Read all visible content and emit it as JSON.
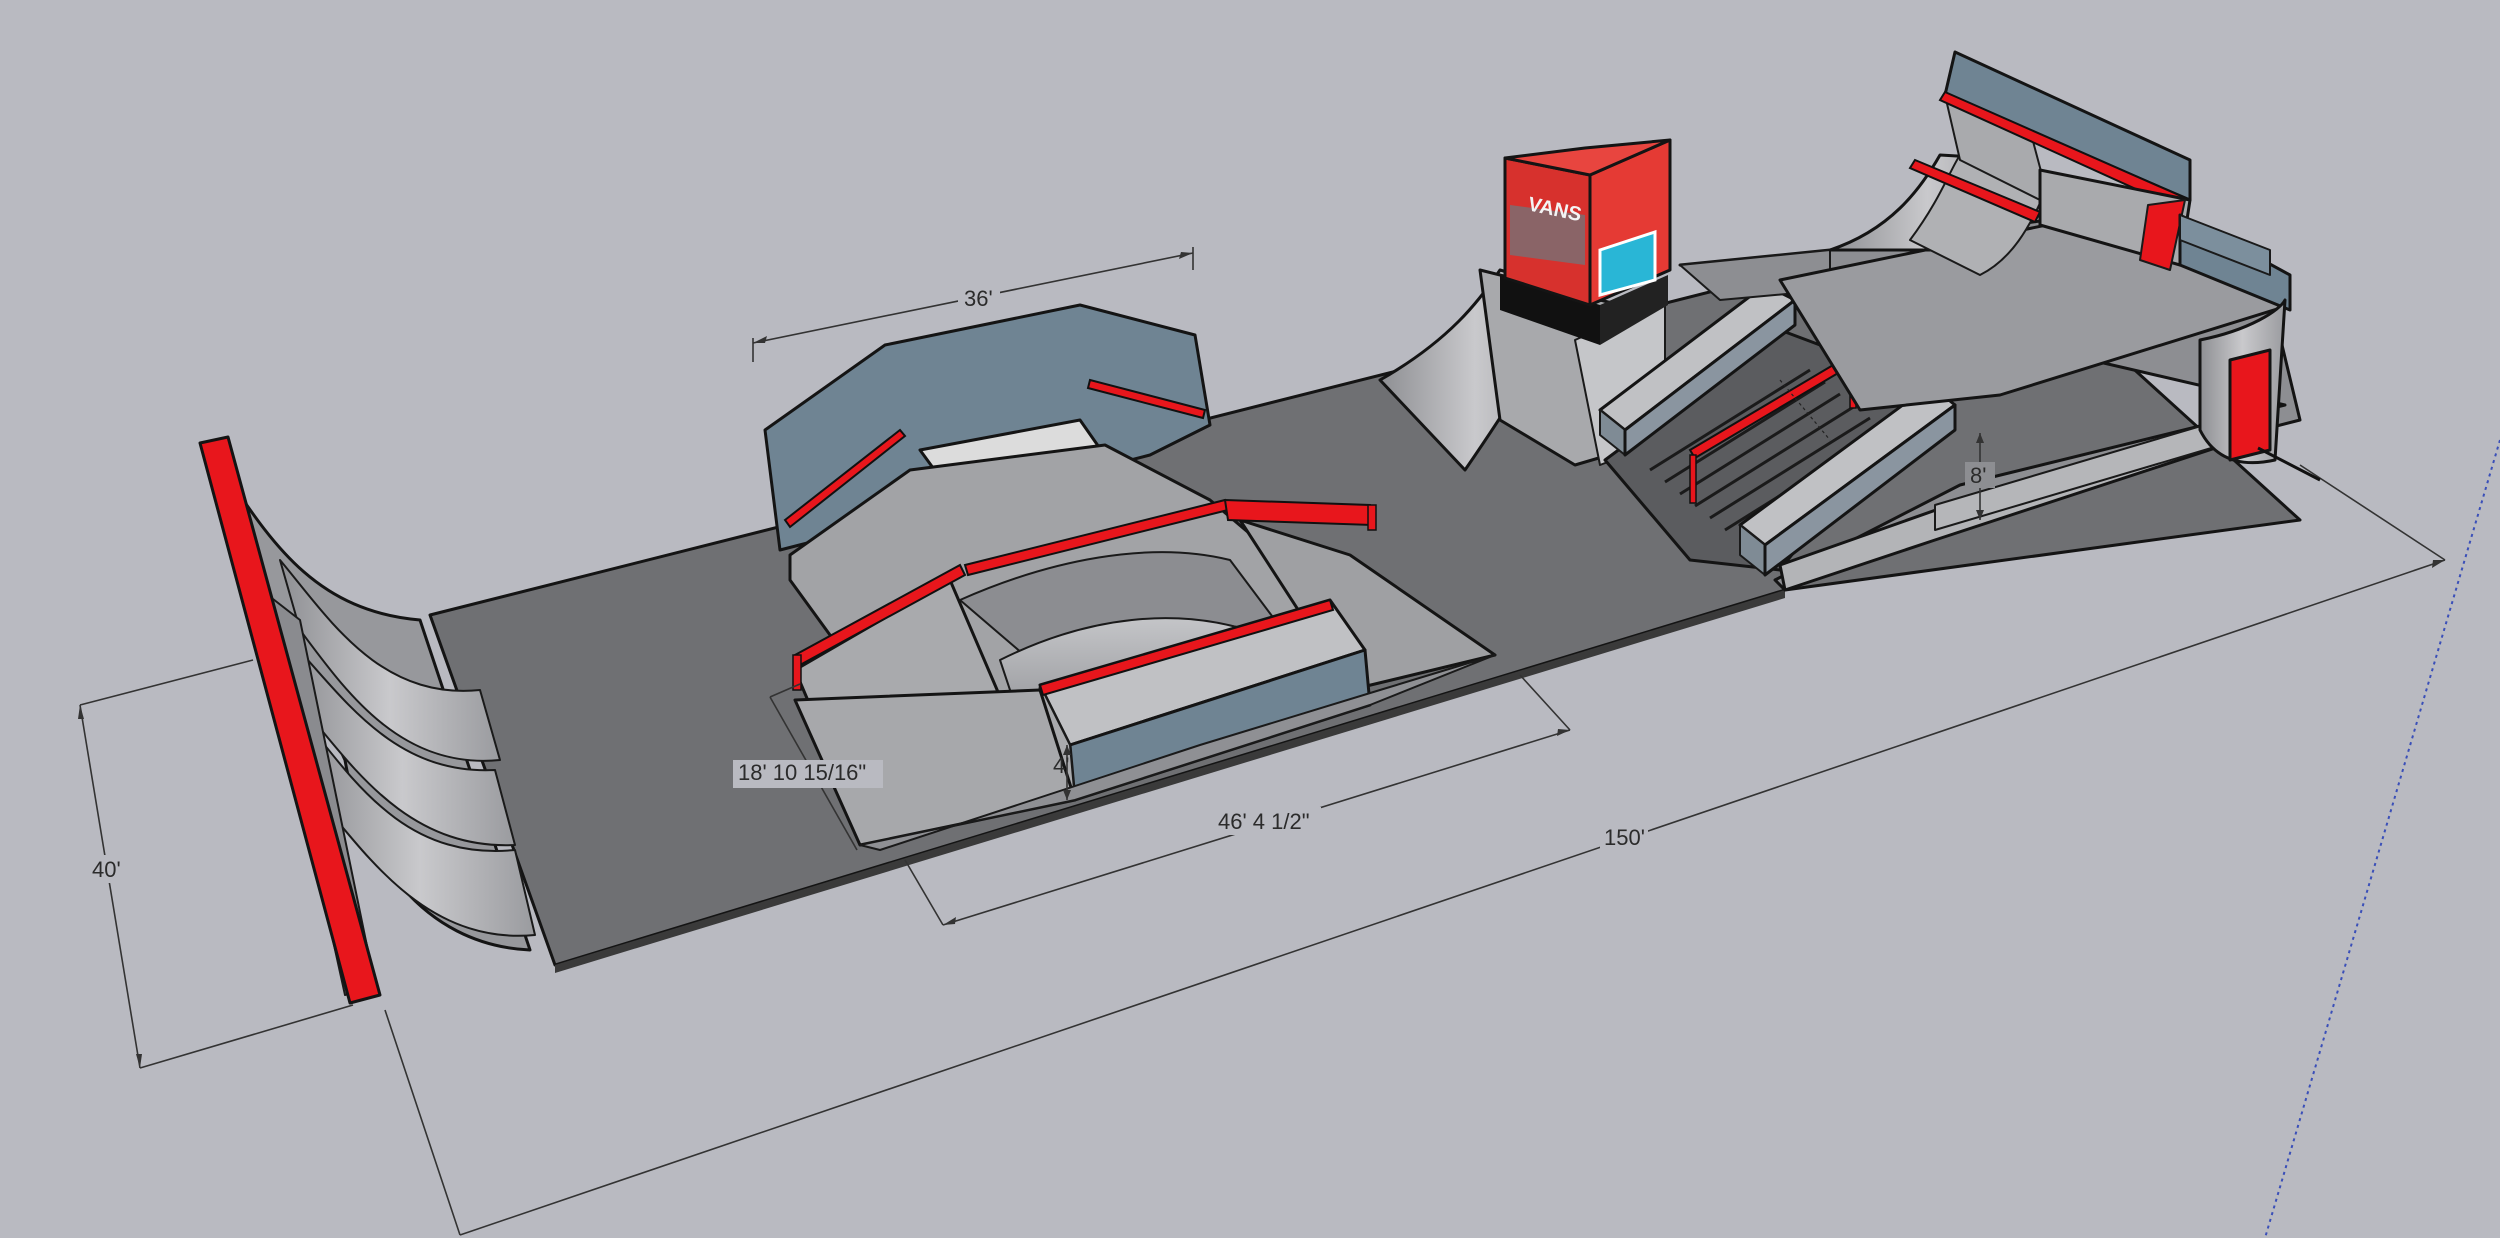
{
  "dimensions": {
    "top_width": "36'",
    "height_a": "18' 10 15/16\"",
    "box_height": "4'",
    "box_length": "46' 4 1/2\"",
    "overall_length": "150'",
    "width": "40'",
    "ramp_height": "8'"
  },
  "sign": {
    "brand": "VANS"
  },
  "colors": {
    "background": "#b9bac1",
    "floor": "#6f7073",
    "accent_red": "#e8161c",
    "steel_blue": "#6f8493",
    "ramp_grey": "#a9aaad"
  }
}
